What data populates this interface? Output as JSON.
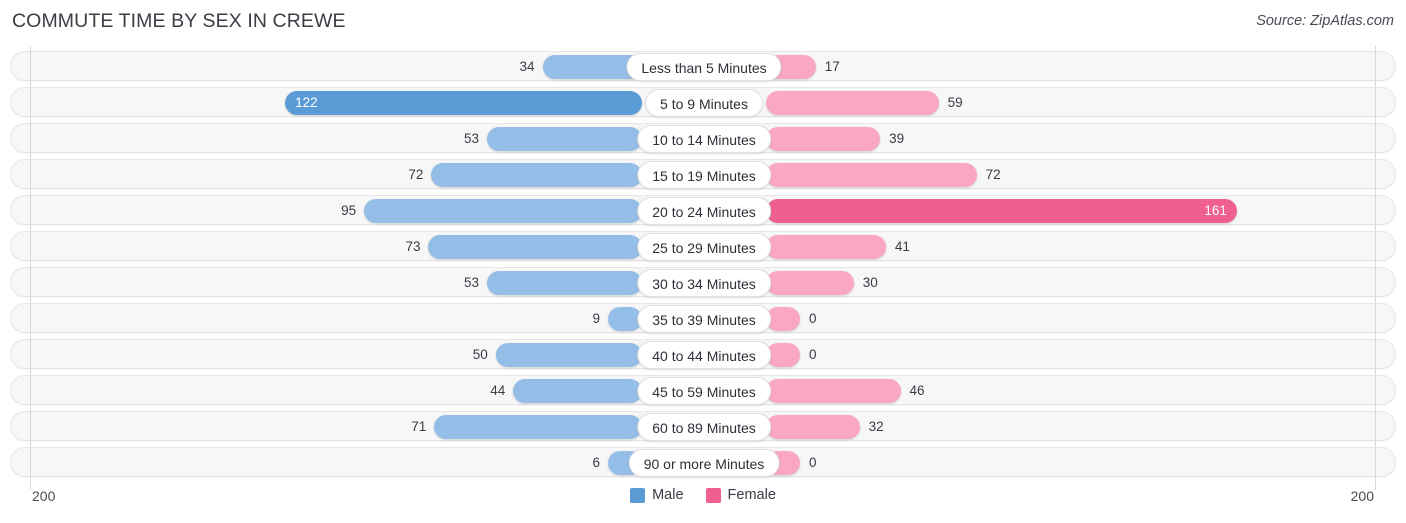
{
  "header": {
    "title": "COMMUTE TIME BY SEX IN CREWE",
    "source": "Source: ZipAtlas.com"
  },
  "legend": {
    "male_label": "Male",
    "female_label": "Female",
    "male_color": "#5b9bd5",
    "female_color": "#ef5f8f"
  },
  "axis": {
    "left_max": "200",
    "right_max": "200"
  },
  "chart_data": {
    "type": "bar",
    "title": "COMMUTE TIME BY SEX IN CREWE",
    "subtitle": "Source: ZipAtlas.com",
    "orientation": "horizontal-diverging",
    "xlabel": "",
    "ylabel": "",
    "xlim": [
      -200,
      200
    ],
    "axis_max": 200,
    "grid": false,
    "legend_position": "bottom-center",
    "categories": [
      "Less than 5 Minutes",
      "5 to 9 Minutes",
      "10 to 14 Minutes",
      "15 to 19 Minutes",
      "20 to 24 Minutes",
      "25 to 29 Minutes",
      "30 to 34 Minutes",
      "35 to 39 Minutes",
      "40 to 44 Minutes",
      "45 to 59 Minutes",
      "60 to 89 Minutes",
      "90 or more Minutes"
    ],
    "series": [
      {
        "name": "Male",
        "color": "#94bee8",
        "peak_color": "#5b9bd5",
        "values": [
          34,
          122,
          53,
          72,
          95,
          73,
          53,
          9,
          50,
          44,
          71,
          6
        ],
        "labels": [
          "34",
          "122",
          "53",
          "72",
          "95",
          "73",
          "53",
          "9",
          "50",
          "44",
          "71",
          "6"
        ]
      },
      {
        "name": "Female",
        "color": "#f9a7c3",
        "peak_color": "#ef5f8f",
        "values": [
          17,
          59,
          39,
          72,
          161,
          41,
          30,
          0,
          0,
          46,
          32,
          0
        ],
        "labels": [
          "17",
          "59",
          "39",
          "72",
          "161",
          "41",
          "30",
          "0",
          "0",
          "46",
          "32",
          "0"
        ]
      }
    ]
  }
}
